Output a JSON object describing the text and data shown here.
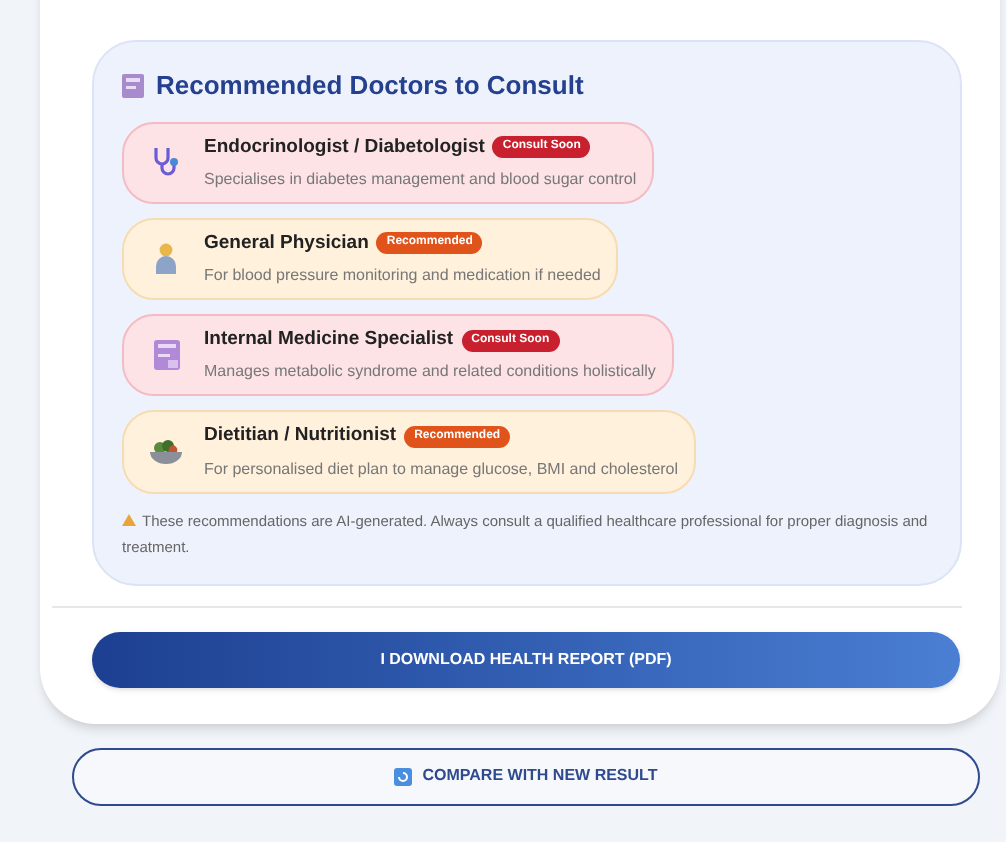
{
  "section": {
    "title": "Recommended Doctors to Consult",
    "doctors": [
      {
        "name": "Endocrinologist / Diabetologist",
        "badge": "Consult Soon",
        "kind": "urgent",
        "description": "Specialises in diabetes management and blood sugar control"
      },
      {
        "name": "General Physician",
        "badge": "Recommended",
        "kind": "recommended",
        "description": "For blood pressure monitoring and medication if needed"
      },
      {
        "name": "Internal Medicine Specialist",
        "badge": "Consult Soon",
        "kind": "urgent",
        "description": "Manages metabolic syndrome and related conditions holistically"
      },
      {
        "name": "Dietitian / Nutritionist",
        "badge": "Recommended",
        "kind": "recommended",
        "description": "For personalised diet plan to manage glucose, BMI and cholesterol"
      }
    ],
    "disclaimer": "These recommendations are AI-generated. Always consult a qualified healthcare professional for proper diagnosis and treatment."
  },
  "buttons": [
    {
      "label": "I DOWNLOAD HEALTH REPORT (PDF)",
      "kind": "primary"
    },
    {
      "label": "COMPARE WITH NEW RESULT",
      "kind": "outline"
    }
  ]
}
